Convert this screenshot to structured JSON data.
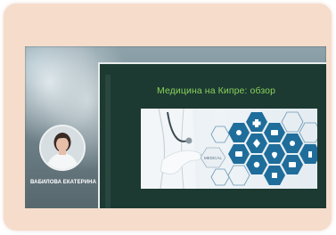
{
  "slide": {
    "title": "Медицина на Кипре: обзор"
  },
  "speaker": {
    "name": "ВАБИЛОВА ЕКАТЕРИНА"
  },
  "image_labels": {
    "medical_label": "MEDICAL"
  },
  "colors": {
    "card_background": "#f6dccb",
    "slide_background": "#1c3a32",
    "title_color": "#8ad05a",
    "hex_icon_color": "#1f6d9b"
  }
}
